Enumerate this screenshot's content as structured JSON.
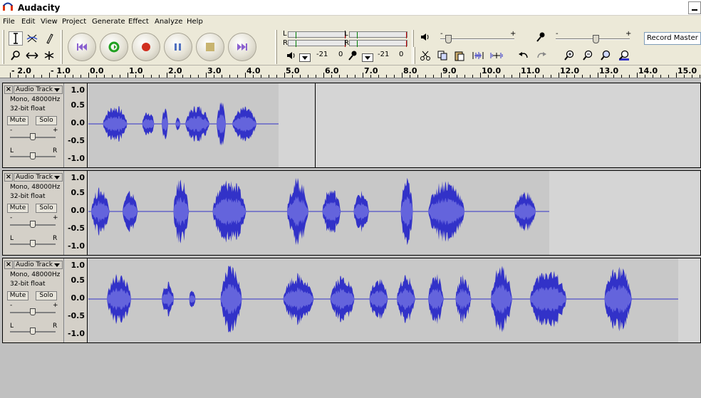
{
  "window": {
    "title": "Audacity"
  },
  "menu": [
    "File",
    "Edit",
    "View",
    "Project",
    "Generate",
    "Effect",
    "Analyze",
    "Help"
  ],
  "meter": {
    "left_label": "L",
    "right_label": "R",
    "playback_db": "-21",
    "playback_zero": "0",
    "record_db": "-21",
    "record_zero": "0"
  },
  "mixer": {
    "minus": "-",
    "plus": "+",
    "record_source": "Record Master"
  },
  "ruler": {
    "labels": [
      "- 2.0",
      "- 1.0",
      "0.0",
      "1.0",
      "2.0",
      "3.0",
      "4.0",
      "5.0",
      "6.0",
      "7.0",
      "8.0",
      "9.0",
      "10.0",
      "11.0",
      "12.0",
      "13.0",
      "14.0",
      "15.0"
    ]
  },
  "tracks": [
    {
      "name": "Audio Track",
      "format": "Mono, 48000Hz",
      "bitdepth": "32-bit float",
      "mute": "Mute",
      "solo": "Solo",
      "gain_minus": "-",
      "gain_plus": "+",
      "pan_left": "L",
      "pan_right": "R",
      "scale": [
        "1.0",
        "0.5",
        "0.0",
        "-0.5",
        "-1.0"
      ]
    },
    {
      "name": "Audio Track",
      "format": "Mono, 48000Hz",
      "bitdepth": "32-bit float",
      "mute": "Mute",
      "solo": "Solo",
      "gain_minus": "-",
      "gain_plus": "+",
      "pan_left": "L",
      "pan_right": "R",
      "scale": [
        "1.0",
        "0.5",
        "0.0",
        "-0.5",
        "-1.0"
      ]
    },
    {
      "name": "Audio Track",
      "format": "Mono, 48000Hz",
      "bitdepth": "32-bit float",
      "mute": "Mute",
      "solo": "Solo",
      "gain_minus": "-",
      "gain_plus": "+",
      "pan_left": "L",
      "pan_right": "R",
      "scale": [
        "1.0",
        "0.5",
        "0.0",
        "-0.5",
        "-1.0"
      ]
    }
  ],
  "clips": [
    {
      "start_s": 0.0,
      "end_s": 4.8,
      "bursts": [
        [
          0.3,
          1.1,
          0.55
        ],
        [
          1.3,
          1.7,
          0.4
        ],
        [
          1.8,
          2.0,
          0.5
        ],
        [
          2.15,
          2.3,
          0.25
        ],
        [
          2.4,
          3.2,
          0.55
        ],
        [
          3.2,
          3.5,
          0.7
        ],
        [
          3.6,
          4.4,
          0.5
        ]
      ]
    },
    {
      "start_s": 0.0,
      "end_s": 11.7,
      "bursts": [
        [
          0.0,
          0.6,
          0.7
        ],
        [
          0.8,
          1.3,
          0.6
        ],
        [
          2.1,
          2.6,
          1.0
        ],
        [
          3.1,
          4.2,
          0.95
        ],
        [
          5.0,
          5.7,
          0.98
        ],
        [
          5.9,
          6.5,
          0.7
        ],
        [
          6.7,
          7.2,
          0.6
        ],
        [
          7.9,
          8.3,
          0.98
        ],
        [
          8.6,
          9.8,
          0.95
        ],
        [
          10.8,
          11.5,
          0.6
        ]
      ]
    },
    {
      "start_s": 0.0,
      "end_s": 15.0,
      "bursts": [
        [
          0.4,
          1.2,
          0.75
        ],
        [
          1.8,
          2.2,
          0.5
        ],
        [
          2.5,
          2.7,
          0.35
        ],
        [
          3.3,
          4.0,
          0.98
        ],
        [
          4.9,
          5.9,
          0.75
        ],
        [
          6.1,
          6.9,
          0.7
        ],
        [
          7.1,
          7.7,
          0.65
        ],
        [
          7.8,
          8.4,
          0.7
        ],
        [
          8.6,
          9.1,
          0.75
        ],
        [
          9.3,
          9.8,
          0.7
        ],
        [
          10.2,
          10.9,
          0.98
        ],
        [
          11.2,
          12.4,
          0.9
        ],
        [
          13.1,
          14.0,
          1.0
        ]
      ]
    }
  ],
  "play_cursor_s": 5.7,
  "colors": {
    "wave_fill": "#3232c8",
    "wave_rms": "#6464dc",
    "wave_bg": "#c8c8c8",
    "empty_bg": "#d5d5d5"
  }
}
